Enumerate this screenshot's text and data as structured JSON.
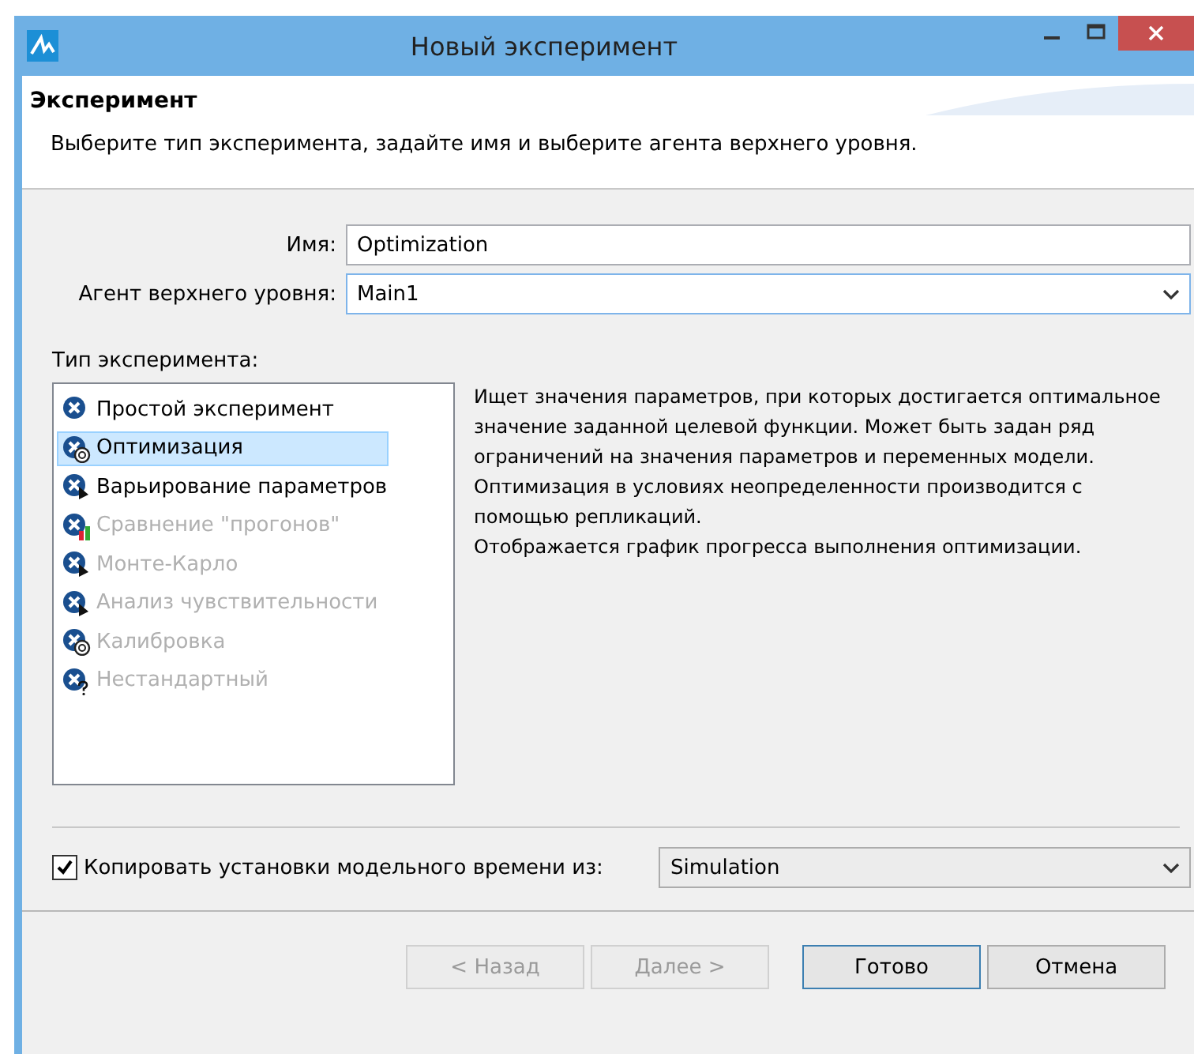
{
  "window": {
    "title": "Новый эксперимент"
  },
  "header": {
    "title": "Эксперимент",
    "description": "Выберите тип эксперимента, задайте имя и выберите агента верхнего уровня."
  },
  "name_field": {
    "label": "Имя:",
    "value": "Optimization"
  },
  "agent_field": {
    "label": "Агент верхнего уровня:",
    "value": "Main1"
  },
  "experiment_types": {
    "label": "Тип эксперимента:",
    "items": [
      {
        "label": "Простой эксперимент",
        "kind": "plain",
        "selected": false,
        "disabled": false
      },
      {
        "label": "Оптимизация",
        "kind": "spiral",
        "selected": true,
        "disabled": false
      },
      {
        "label": "Варьирование параметров",
        "kind": "arrow",
        "selected": false,
        "disabled": false
      },
      {
        "label": "Сравнение \"прогонов\"",
        "kind": "chart",
        "selected": false,
        "disabled": true
      },
      {
        "label": "Монте-Карло",
        "kind": "arrow",
        "selected": false,
        "disabled": true
      },
      {
        "label": "Анализ чувствительности",
        "kind": "arrow",
        "selected": false,
        "disabled": true
      },
      {
        "label": "Калибровка",
        "kind": "spiral",
        "selected": false,
        "disabled": true
      },
      {
        "label": "Нестандартный",
        "kind": "question",
        "selected": false,
        "disabled": true
      }
    ]
  },
  "description": [
    "Ищет значения параметров, при которых достигается оптимальное значение заданной целевой функции. Может быть задан ряд ограничений на значения параметров и переменных модели.",
    "Оптимизация в условиях неопределенности производится с помощью репликаций.",
    "Отображается график прогресса выполнения оптимизации."
  ],
  "copy_time": {
    "label": "Копировать установки модельного времени из:",
    "checked": true,
    "value": "Simulation"
  },
  "buttons": [
    {
      "label": "< Назад",
      "disabled": true,
      "default": false
    },
    {
      "label": "Далее >",
      "disabled": true,
      "default": false
    },
    {
      "label": "Готово",
      "disabled": false,
      "default": true
    },
    {
      "label": "Отмена",
      "disabled": false,
      "default": false
    }
  ]
}
